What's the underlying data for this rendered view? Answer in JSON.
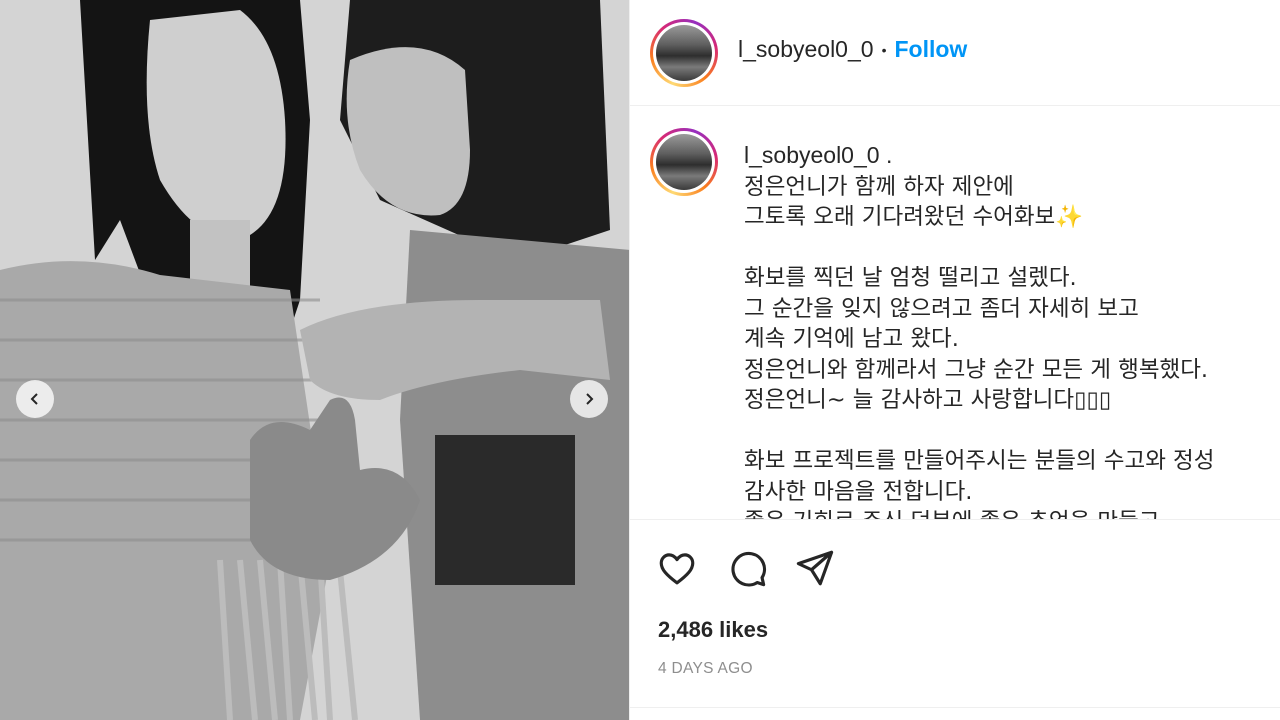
{
  "post": {
    "username": "l_sobyeol0_0",
    "follow_label": "Follow",
    "separator": "•",
    "caption_user": "l_sobyeol0_0 .",
    "caption_lines": [
      "정은언니가 함께 하자 제안에",
      "그토록 오래 기다려왔던 수어화보✨",
      "",
      "화보를 찍던 날 엄청 떨리고 설렜다.",
      "그 순간을 잊지 않으려고 좀더 자세히 보고",
      "계속 기억에 남고 왔다.",
      "정은언니와 함께라서 그냥 순간 모든 게 행복했다.",
      "정은언니~ 늘 감사하고 사랑합니다▯▯▯",
      "",
      "화보 프로젝트를 만들어주시는 분들의 수고와 정성",
      "감사한 마음을 전합니다.",
      "좋은 기회로 주신 덕분에 좋은 추억을 만들고"
    ],
    "likes": "2,486 likes",
    "time_ago": "4 DAYS AGO"
  },
  "icons": {
    "like": "heart-icon",
    "comment": "comment-icon",
    "share": "share-icon",
    "prev": "chevron-left-icon",
    "next": "chevron-right-icon"
  },
  "colors": {
    "follow": "#0095f6",
    "muted": "#8e8e8e",
    "text": "#262626",
    "border": "#efefef"
  }
}
